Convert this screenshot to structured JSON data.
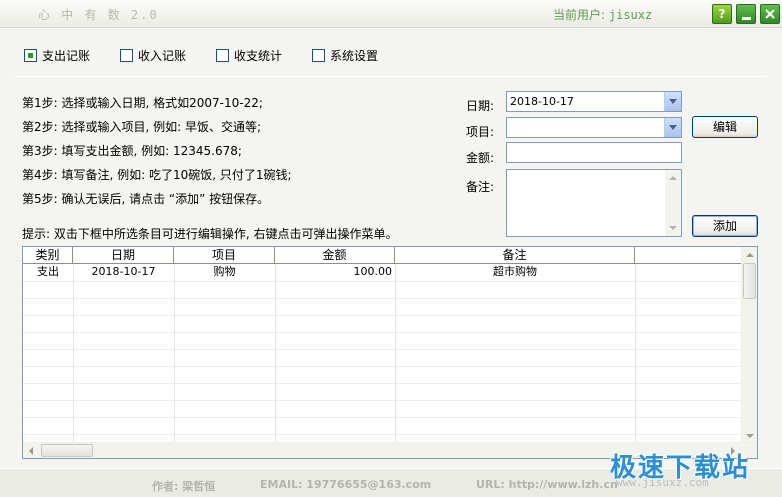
{
  "window": {
    "title": "心 中 有 数  2.0",
    "current_user_label": "当前用户:",
    "current_user": "jisuxz",
    "help_label": "?"
  },
  "modes": [
    {
      "label": "支出记账",
      "checked": true
    },
    {
      "label": "收入记账",
      "checked": false
    },
    {
      "label": "收支统计",
      "checked": false
    },
    {
      "label": "系统设置",
      "checked": false
    }
  ],
  "steps": [
    "第1步: 选择或输入日期, 格式如2007-10-22;",
    "第2步: 选择或输入项目, 例如: 早饭、交通等;",
    "第3步: 填写支出金额, 例如: 12345.678;",
    "第4步: 填写备注, 例如: 吃了10碗饭, 只付了1碗钱;",
    "第5步: 确认无误后, 请点击 “添加” 按钮保存。"
  ],
  "form": {
    "date_label": "日期:",
    "date_value": "2018-10-17",
    "item_label": "项目:",
    "item_value": "",
    "amount_label": "金额:",
    "amount_value": "",
    "note_label": "备注:",
    "note_value": "",
    "edit_button": "编辑",
    "add_button": "添加"
  },
  "hint": "提示: 双击下框中所选条目可进行编辑操作, 右键点击可弹出操作菜单。",
  "table": {
    "columns": [
      "类别",
      "日期",
      "项目",
      "金额",
      "备注"
    ],
    "rows": [
      [
        "支出",
        "2018-10-17",
        "购物",
        "100.00",
        "超市购物"
      ]
    ]
  },
  "footer": {
    "author": "作者: 梁哲恒",
    "email": "EMAIL: 19776655@163.com",
    "url": "URL: http://www.lzh.cn"
  },
  "watermark": {
    "text": "极速下载站",
    "url": "www.jisuxz.com"
  }
}
